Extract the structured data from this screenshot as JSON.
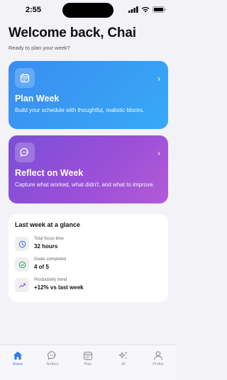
{
  "status_bar": {
    "time": "2:55"
  },
  "header": {
    "title": "Welcome back, Chai",
    "subtitle": "Ready to plan your week?"
  },
  "cards": [
    {
      "title": "Plan Week",
      "description": "Build your schedule with thoughtful, realistic blocks.",
      "icon": "calendar-icon",
      "color": "#3a8df0"
    },
    {
      "title": "Reflect on Week",
      "description": "Capture what worked, what didn't, and what to improve.",
      "icon": "chat-bubble-icon",
      "color": "#8a4fd8"
    }
  ],
  "glance": {
    "title": "Last week at a glance",
    "stats": [
      {
        "label": "Total focus time",
        "value": "32 hours",
        "icon": "clock-icon",
        "color": "#3a7bd5"
      },
      {
        "label": "Goals completed",
        "value": "4 of 5",
        "icon": "check-circle-icon",
        "color": "#34a853"
      },
      {
        "label": "Productivity trend",
        "value": "+12% vs last week",
        "icon": "trend-up-icon",
        "color": "#8a4fd8"
      }
    ]
  },
  "tab_bar": {
    "active_color": "#2f7bf0",
    "tabs": [
      {
        "label": "Home",
        "icon": "home-icon",
        "active": true
      },
      {
        "label": "Reflect",
        "icon": "chat-bubble-icon",
        "active": false
      },
      {
        "label": "Plan",
        "icon": "calendar-icon",
        "active": false
      },
      {
        "label": "AI",
        "icon": "sparkles-icon",
        "active": false
      },
      {
        "label": "Profile",
        "icon": "person-icon",
        "active": false
      }
    ]
  }
}
